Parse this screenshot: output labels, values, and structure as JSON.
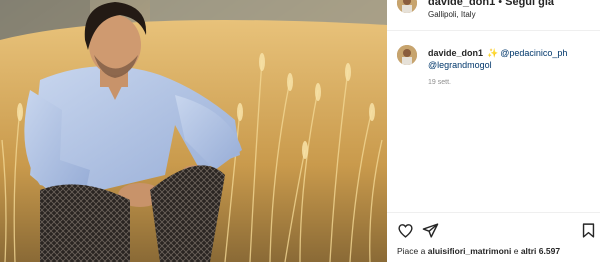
{
  "header": {
    "username": "davide_don1",
    "separator": "•",
    "follow_label": "Segui già",
    "location": "Gallipoli, Italy"
  },
  "caption": {
    "username": "davide_don1",
    "sparkle": "✨",
    "mention_1": "@pedacinico_ph",
    "mention_2": "@legrandmogol"
  },
  "timestamp": "19 sett.",
  "likes": {
    "prefix": "Piace a",
    "user": "aluisifiori_matrimoni",
    "middle": "e",
    "others": "altri 6.597"
  },
  "icons": {
    "like": "heart-icon",
    "share": "paper-plane-icon",
    "save": "bookmark-icon"
  },
  "colors": {
    "text": "#262626",
    "muted": "#8e8e8e",
    "mention": "#00376b",
    "divider": "#efefef"
  }
}
